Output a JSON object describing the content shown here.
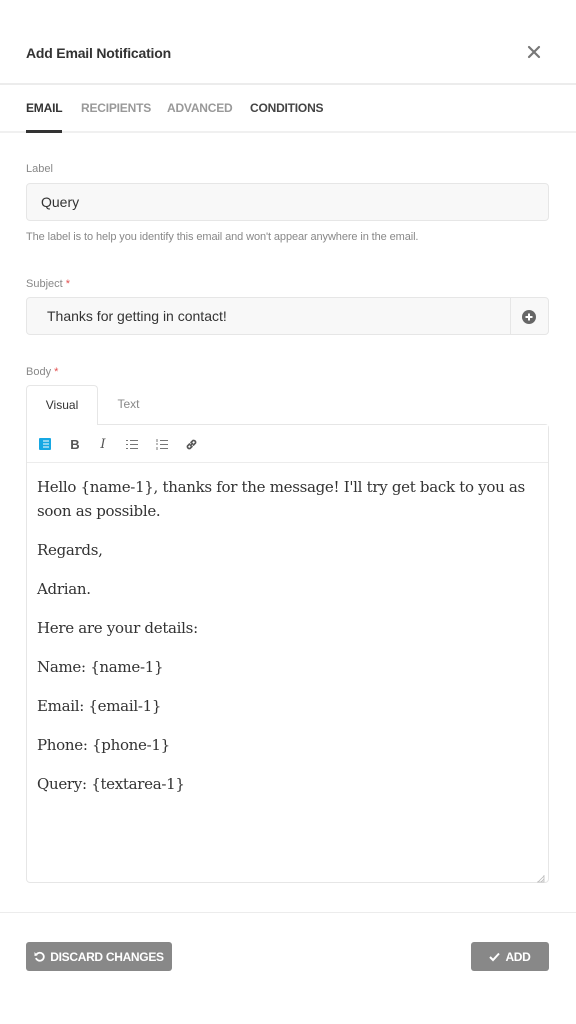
{
  "header": {
    "title": "Add Email Notification",
    "close_icon": "close-icon"
  },
  "tabs": [
    {
      "label": "EMAIL",
      "active": true
    },
    {
      "label": "RECIPIENTS",
      "active": false
    },
    {
      "label": "ADVANCED",
      "active": false
    },
    {
      "label": "CONDITIONS",
      "active": false
    }
  ],
  "label_field": {
    "label": "Label",
    "value": "Query",
    "helper": "The label is to help you identify this email and won't appear anywhere in the email."
  },
  "subject_field": {
    "label": "Subject",
    "required_mark": "*",
    "value": "Thanks for getting in contact!",
    "addon_icon": "plus-circle-icon"
  },
  "body_field": {
    "label": "Body",
    "required_mark": "*",
    "editor_tabs": [
      {
        "label": "Visual",
        "active": true
      },
      {
        "label": "Text",
        "active": false
      }
    ],
    "toolbar": [
      "form-fields-icon",
      "bold-icon",
      "italic-icon",
      "bullet-list-icon",
      "numbered-list-icon",
      "link-icon"
    ],
    "paragraphs": [
      "Hello {name-1}, thanks for the message! I'll try get back to you as soon as possible.",
      "Regards,",
      "Adrian.",
      "Here are your details:",
      "Name: {name-1}",
      "Email: {email-1}",
      "Phone: {phone-1}",
      "Query: {textarea-1}"
    ]
  },
  "footer": {
    "discard_label": "DISCARD CHANGES",
    "add_label": "ADD"
  },
  "colors": {
    "accent": "#17a8e3",
    "button": "#888888",
    "required": "#e35050"
  }
}
